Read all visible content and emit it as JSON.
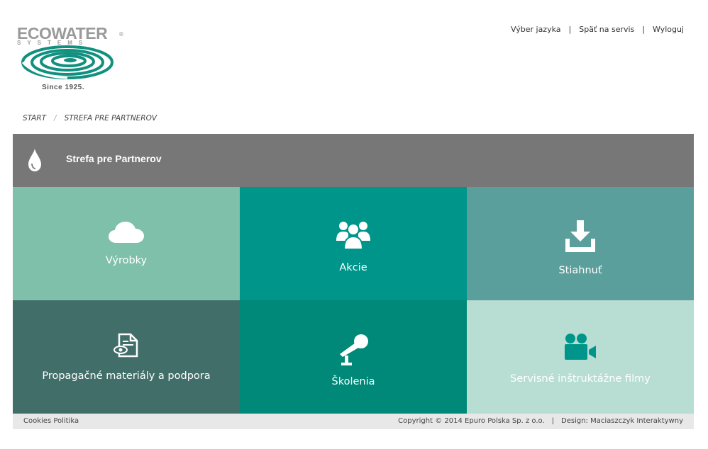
{
  "logo": {
    "word": "ECOWATER",
    "sub": "SYSTEMS",
    "reg": "®",
    "since": "Since 1925."
  },
  "top_nav": {
    "language": "Výber jazyka",
    "back": "Späť na servis",
    "logout": "Wyloguj",
    "separator": "|"
  },
  "breadcrumb": {
    "start": "START",
    "separator": "/",
    "current": "STREFA PRE PARTNEROV"
  },
  "header": {
    "title": "Strefa pre Partnerov",
    "icon": "drop-icon"
  },
  "tiles": [
    {
      "label": "Výrobky",
      "icon": "cloud-icon",
      "color": "#7fc0aa"
    },
    {
      "label": "Akcie",
      "icon": "users-icon",
      "color": "#00958a"
    },
    {
      "label": "Stiahnuť",
      "icon": "download-icon",
      "color": "#5a9f9c"
    },
    {
      "label": "Propagačné materiály a podpora",
      "icon": "document-eye-icon",
      "color": "#426e6a"
    },
    {
      "label": "Školenia",
      "icon": "microphone-icon",
      "color": "#008878"
    },
    {
      "label": "Servisné inštruktážne filmy",
      "icon": "video-camera-icon",
      "color": "#b8ddd2"
    }
  ],
  "footer": {
    "cookies": "Cookies Politika",
    "copyright": "Copyright © 2014 Epuro Polska Sp. z o.o.",
    "separator": "|",
    "design": "Design: Maciaszczyk Interaktywny"
  }
}
